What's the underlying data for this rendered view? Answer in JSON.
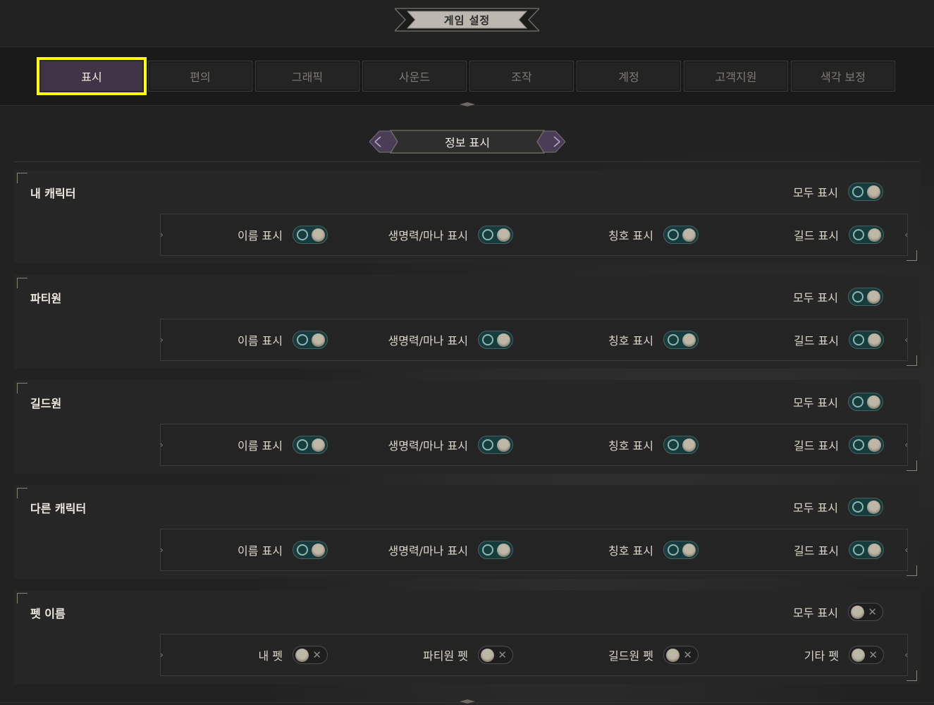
{
  "window": {
    "title": "게임 설정"
  },
  "tabs": [
    {
      "label": "표시",
      "active": true
    },
    {
      "label": "편의",
      "active": false
    },
    {
      "label": "그래픽",
      "active": false
    },
    {
      "label": "사운드",
      "active": false
    },
    {
      "label": "조작",
      "active": false
    },
    {
      "label": "계정",
      "active": false
    },
    {
      "label": "고객지원",
      "active": false
    },
    {
      "label": "색각 보정",
      "active": false
    }
  ],
  "section": {
    "title": "정보 표시"
  },
  "groups": [
    {
      "title": "내 캐릭터",
      "all_label": "모두 표시",
      "all_on": true,
      "options": [
        {
          "label": "이름 표시",
          "on": true
        },
        {
          "label": "생명력/마나 표시",
          "on": true
        },
        {
          "label": "칭호 표시",
          "on": true
        },
        {
          "label": "길드 표시",
          "on": true
        }
      ]
    },
    {
      "title": "파티원",
      "all_label": "모두 표시",
      "all_on": true,
      "options": [
        {
          "label": "이름 표시",
          "on": true
        },
        {
          "label": "생명력/마나 표시",
          "on": true
        },
        {
          "label": "칭호 표시",
          "on": true
        },
        {
          "label": "길드 표시",
          "on": true
        }
      ]
    },
    {
      "title": "길드원",
      "all_label": "모두 표시",
      "all_on": true,
      "options": [
        {
          "label": "이름 표시",
          "on": true
        },
        {
          "label": "생명력/마나 표시",
          "on": true
        },
        {
          "label": "칭호 표시",
          "on": true
        },
        {
          "label": "길드 표시",
          "on": true
        }
      ]
    },
    {
      "title": "다른 캐릭터",
      "all_label": "모두 표시",
      "all_on": true,
      "options": [
        {
          "label": "이름 표시",
          "on": true
        },
        {
          "label": "생명력/마나 표시",
          "on": true
        },
        {
          "label": "칭호 표시",
          "on": true
        },
        {
          "label": "길드 표시",
          "on": true
        }
      ]
    },
    {
      "title": "펫 이름",
      "all_label": "모두 표시",
      "all_on": false,
      "options": [
        {
          "label": "내 펫",
          "on": false
        },
        {
          "label": "파티원 펫",
          "on": false
        },
        {
          "label": "길드원 펫",
          "on": false
        },
        {
          "label": "기타 펫",
          "on": false
        }
      ]
    }
  ],
  "colors": {
    "active_tab_highlight": "#ffff00",
    "toggle_on": "#163c3d",
    "toggle_off": "#1e1e1e",
    "background": "#222222"
  },
  "icons": {
    "toggle_on_indicator": "ring-icon",
    "toggle_off_indicator": "x-icon",
    "panel_arrows": "chevron-icon"
  }
}
